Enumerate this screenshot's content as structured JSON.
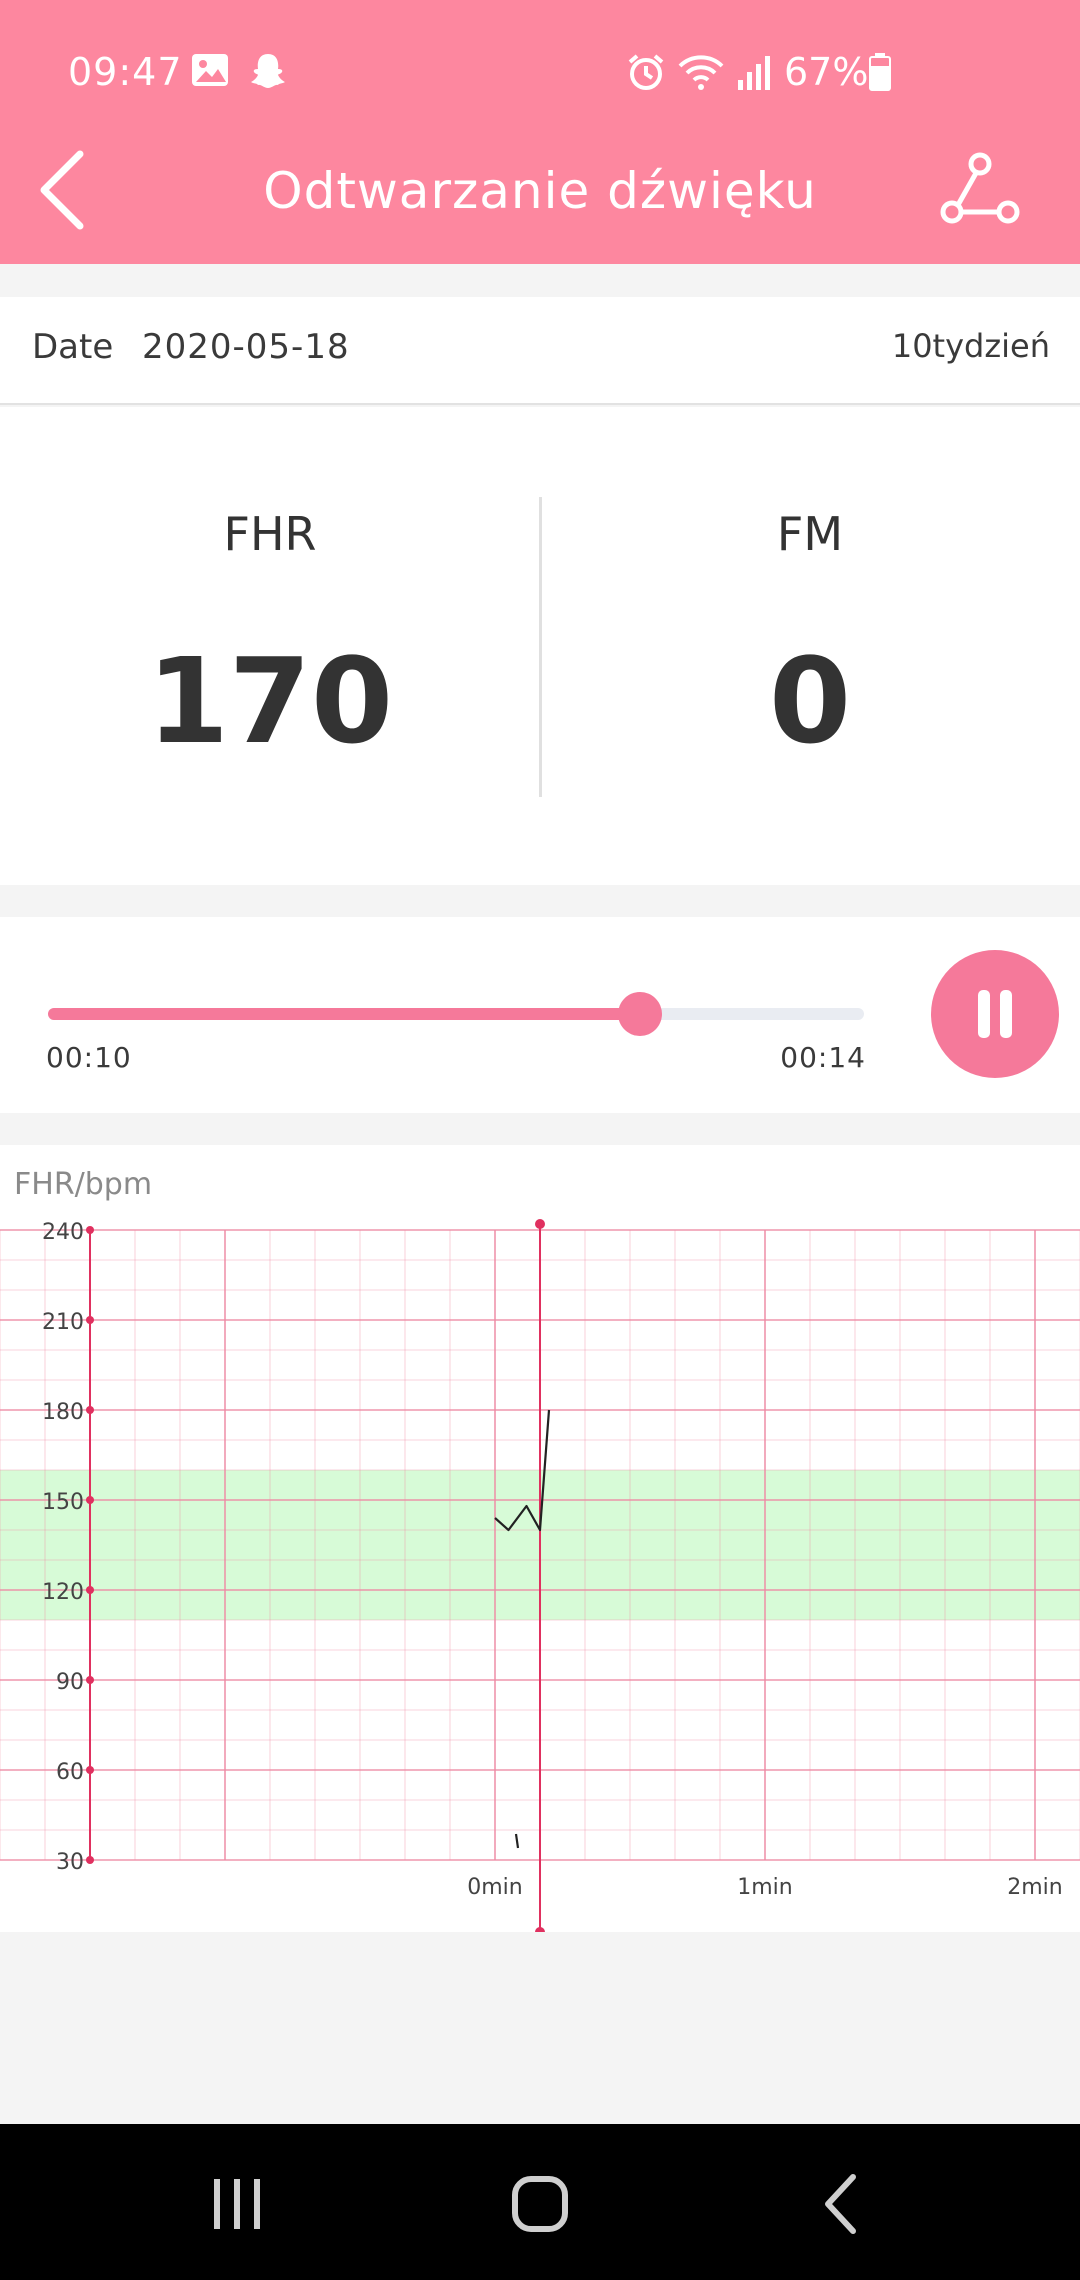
{
  "status_bar": {
    "time": "09:47",
    "battery": "67%",
    "icons": [
      "image-icon",
      "snapchat-icon",
      "alarm-icon",
      "wifi-icon",
      "signal-icon",
      "battery-icon"
    ]
  },
  "header": {
    "title": "Odtwarzanie dźwięku",
    "back_icon": "back-arrow-icon",
    "share_icon": "share-icon",
    "color": "#fd879f"
  },
  "info": {
    "date_label": "Date",
    "date_value": "2020-05-18",
    "week": "10tydzień"
  },
  "stats": {
    "fhr_label": "FHR",
    "fhr_value": "170",
    "fm_label": "FM",
    "fm_value": "0"
  },
  "player": {
    "current_time": "00:10",
    "total_time": "00:14",
    "progress": 0.725,
    "pause_icon": "pause-icon",
    "accent": "#f5799a"
  },
  "chart_data": {
    "type": "line",
    "ylabel": "FHR/bpm",
    "ylim": [
      30,
      240
    ],
    "y_ticks": [
      240,
      210,
      180,
      150,
      120,
      90,
      60,
      30
    ],
    "x_ticks": [
      "0min",
      "1min",
      "2min"
    ],
    "normal_band": [
      110,
      160
    ],
    "band_color": "#d7fbd7",
    "grid_color": "#ee8aa4",
    "series": [
      {
        "x": [
          0,
          3,
          7,
          10,
          12
        ],
        "values": [
          144,
          140,
          148,
          140,
          180
        ]
      }
    ],
    "fm_marks": [
      4
    ]
  },
  "nav_bar": {
    "icons": [
      "recent-apps-icon",
      "home-icon",
      "back-icon"
    ]
  }
}
